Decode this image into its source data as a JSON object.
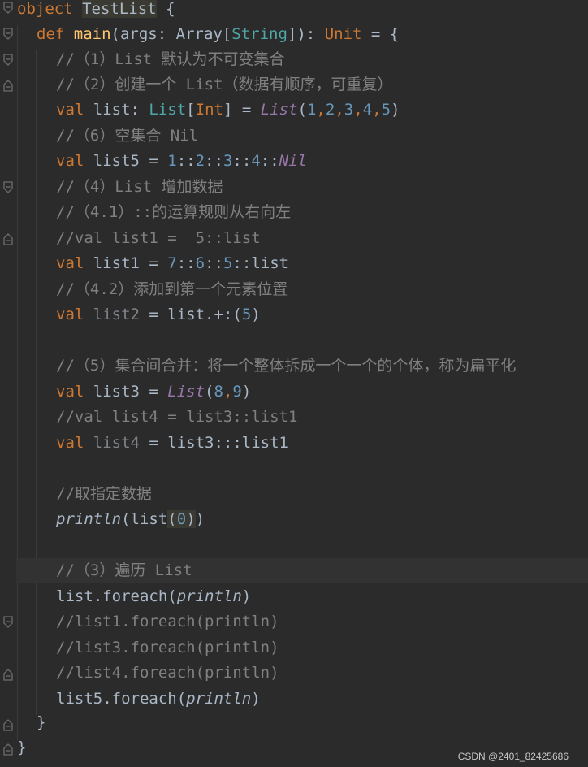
{
  "code": {
    "l1": {
      "kw": "object",
      "name": "TestList",
      "brace": "{"
    },
    "l2": {
      "kw": "def",
      "fn": "main",
      "p1": "(args: ",
      "ty1": "Array",
      "p2": "[",
      "ty2": "String",
      "p3": "]): ",
      "ty3": "Unit",
      "p4": " = {"
    },
    "l3": {
      "cm": "//（1）List 默认为不可变集合"
    },
    "l4": {
      "cm": "//（2）创建一个 List（数据有顺序，可重复）"
    },
    "l5": {
      "kw": "val",
      "t1": " list: ",
      "ty1": "List",
      "t2": "[",
      "ty2": "Int",
      "t3": "] = ",
      "it": "List",
      "t4": "(",
      "n1": "1",
      ",": ",",
      "n2": "2",
      "n3": "3",
      "n4": "4",
      "n5": "5",
      "t5": ")"
    },
    "l6": {
      "cm": "//（6）空集合 Nil"
    },
    "l7": {
      "kw": "val",
      "t1": " list5 = ",
      "n1": "1",
      "c": "::",
      "n2": "2",
      "n3": "3",
      "n4": "4",
      "it": "Nil"
    },
    "l8": {
      "cm": "//（4）List 增加数据"
    },
    "l9": {
      "cm": "//（4.1）::的运算规则从右向左"
    },
    "l10": {
      "cm": "//val list1 =  5::list"
    },
    "l11": {
      "kw": "val",
      "t1": " list1 = ",
      "n1": "7",
      "c": "::",
      "n2": "6",
      "n3": "5",
      "t2": "list"
    },
    "l12": {
      "cm": "//（4.2）添加到第一个元素位置"
    },
    "l13": {
      "kw": "val",
      "g": " list2",
      "t1": " = list.+:(",
      "n1": "5",
      "t2": ")"
    },
    "l14": {
      "cm": "//（5）集合间合并：将一个整体拆成一个一个的个体，称为扁平化"
    },
    "l15": {
      "kw": "val",
      "t1": " list3 = ",
      "it": "List",
      "t2": "(",
      "n1": "8",
      "comma": ",",
      "n2": "9",
      "t3": ")"
    },
    "l16": {
      "cm": "//val list4 = list3::list1"
    },
    "l17": {
      "kw": "val",
      "g": " list4",
      "t1": " = list3:::list1"
    },
    "l18": {
      "cm": "//取指定数据"
    },
    "l19": {
      "it": "println",
      "t1": "(list",
      "t2": "(",
      "n1": "0",
      "t3": ")",
      ")": ")"
    },
    "l20": {
      "cm": "//（3）遍历 List"
    },
    "l21": {
      "t1": "list.foreach(",
      "it": "println",
      "t2": ")"
    },
    "l22": {
      "cm": "//list1.foreach(println)"
    },
    "l23": {
      "cm": "//list3.foreach(println)"
    },
    "l24": {
      "cm": "//list4.foreach(println)"
    },
    "l25": {
      "t1": "list5.foreach(",
      "it": "println",
      "t2": ")"
    },
    "l26": {
      "t1": "}"
    },
    "l27": {
      "t1": "}"
    }
  },
  "watermark": "CSDN @2401_82425686",
  "colors": {
    "background": "#2b2b2b",
    "keyword": "#cc7832",
    "function": "#ffc66d",
    "type": "#4ea6a7",
    "number": "#6897bb",
    "comment": "#808080",
    "italic": "#9876aa"
  }
}
